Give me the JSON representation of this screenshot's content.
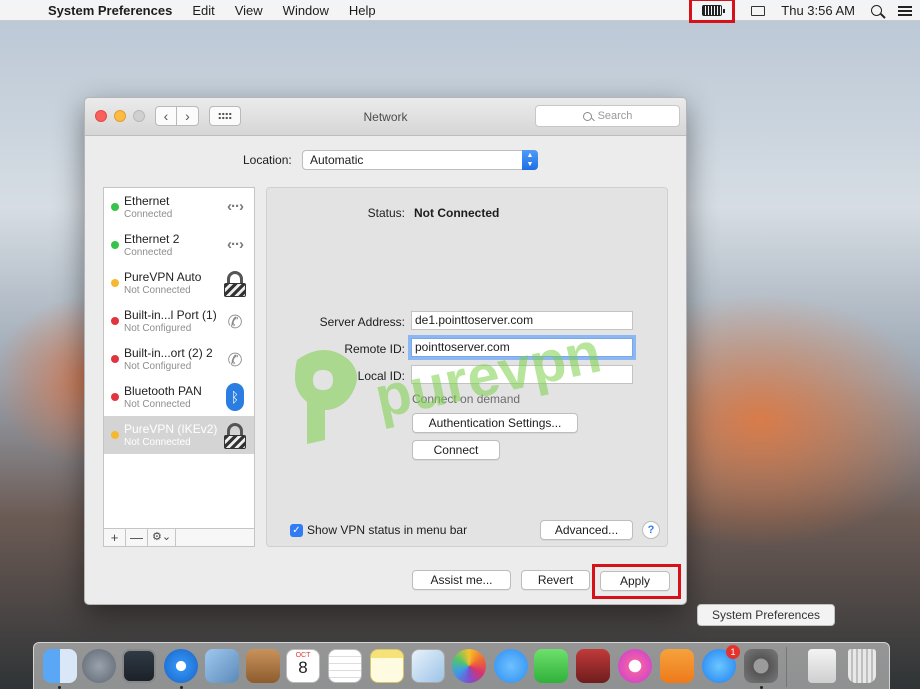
{
  "menubar": {
    "app": "System Preferences",
    "menus": [
      "Edit",
      "View",
      "Window",
      "Help"
    ],
    "clock": "Thu 3:56 AM"
  },
  "window": {
    "title": "Network",
    "search_placeholder": "Search",
    "location_label": "Location:",
    "location_value": "Automatic"
  },
  "services": [
    {
      "name": "Ethernet",
      "status": "Connected",
      "color": "green",
      "icon": "ethernet-icon"
    },
    {
      "name": "Ethernet 2",
      "status": "Connected",
      "color": "green",
      "icon": "ethernet-icon"
    },
    {
      "name": "PureVPN Auto",
      "status": "Not Connected",
      "color": "yellow",
      "icon": "vpn-lock-icon"
    },
    {
      "name": "Built-in...l Port (1)",
      "status": "Not Configured",
      "color": "red",
      "icon": "phone-icon"
    },
    {
      "name": "Built-in...ort (2) 2",
      "status": "Not Configured",
      "color": "red",
      "icon": "phone-icon"
    },
    {
      "name": "Bluetooth PAN",
      "status": "Not Connected",
      "color": "red",
      "icon": "bluetooth-icon"
    },
    {
      "name": "PureVPN (IKEv2)",
      "status": "Not Connected",
      "color": "yellow",
      "icon": "vpn-lock-icon",
      "selected": true
    }
  ],
  "service_toolbar": {
    "add": "+",
    "remove": "—",
    "gear": "⚙︎⌄"
  },
  "detail": {
    "status_label": "Status:",
    "status_value": "Not Connected",
    "server_label": "Server Address:",
    "server_value": "de1.pointtoserver.com",
    "remote_label": "Remote ID:",
    "remote_value": "pointtoserver.com",
    "local_label": "Local ID:",
    "local_value": "",
    "connect_on_demand": "Connect on demand",
    "auth_button": "Authentication Settings...",
    "connect_button": "Connect",
    "show_vpn_status": "Show VPN status in menu bar",
    "advanced_button": "Advanced...",
    "help": "?"
  },
  "footer": {
    "assist_button": "Assist me...",
    "revert_button": "Revert",
    "apply_button": "Apply"
  },
  "watermark": "purevpn",
  "tooltip": "System Preferences",
  "dock": {
    "calendar_month": "OCT",
    "calendar_day": "8",
    "appstore_badge": "1"
  },
  "colors": {
    "accent": "#2f7cf6",
    "highlight_border": "#d6111a",
    "watermark": "#7bd04a"
  }
}
